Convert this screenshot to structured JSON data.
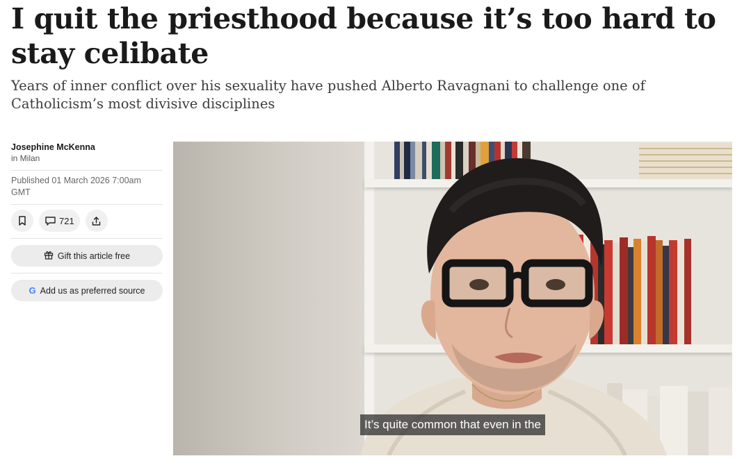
{
  "article": {
    "headline": "I quit the priesthood because it’s too hard to stay celibate",
    "standfirst": "Years of inner conflict over his sexuality have pushed Alberto Ravagnani to challenge one of Catholicism’s most divisive disciplines"
  },
  "byline": {
    "author": "Josephine McKenna",
    "location": "in Milan",
    "published": "Published 01 March 2026 7:00am GMT"
  },
  "actions": {
    "bookmark_icon": "bookmark-icon",
    "comments_icon": "comment-icon",
    "comments_count": "721",
    "share_icon": "share-icon",
    "gift_icon": "gift-icon",
    "gift_label": "Gift this article free",
    "google_letter": "G",
    "preferred_label": "Add us as preferred source"
  },
  "video": {
    "subtitle": "It’s quite common that even in the"
  },
  "colors": {
    "text": "#1a1a1a",
    "muted": "#666666",
    "pill_bg": "#ececec",
    "google_blue": "#4285f4"
  }
}
